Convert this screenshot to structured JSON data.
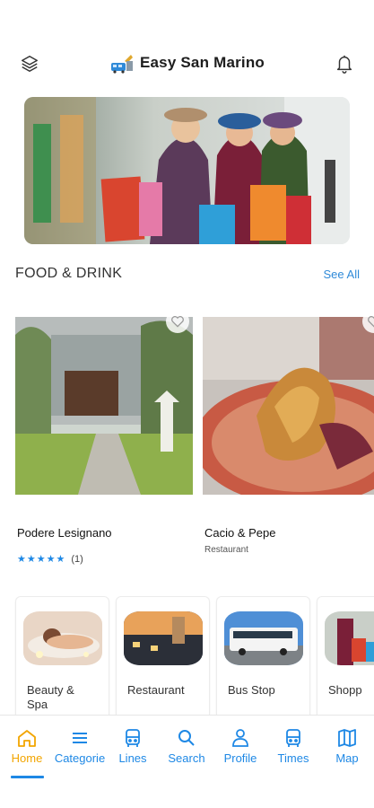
{
  "header": {
    "title": "Easy San Marino",
    "left_icon": "layers-icon",
    "right_icon": "bell-icon"
  },
  "section": {
    "title": "FOOD & DRINK",
    "see_all": "See All"
  },
  "cards": [
    {
      "name": "Podere Lesignano",
      "stars": "★★★★★",
      "rating_count": "(1)"
    },
    {
      "name": "Cacio & Pepe",
      "category": "Restaurant"
    }
  ],
  "categories": [
    {
      "label": "Beauty &\nSpa"
    },
    {
      "label": "Restaurant"
    },
    {
      "label": "Bus Stop"
    },
    {
      "label": "Shopp"
    }
  ],
  "tabs": [
    {
      "label": "Home",
      "icon": "home-icon"
    },
    {
      "label": "Categorie",
      "icon": "menu-icon"
    },
    {
      "label": "Lines",
      "icon": "bus-icon"
    },
    {
      "label": "Search",
      "icon": "search-icon"
    },
    {
      "label": "Profile",
      "icon": "person-icon"
    },
    {
      "label": "Times",
      "icon": "bus-icon"
    },
    {
      "label": "Map",
      "icon": "map-icon"
    }
  ],
  "colors": {
    "accent_blue": "#1e88e5",
    "active_tab": "#f2a500"
  }
}
